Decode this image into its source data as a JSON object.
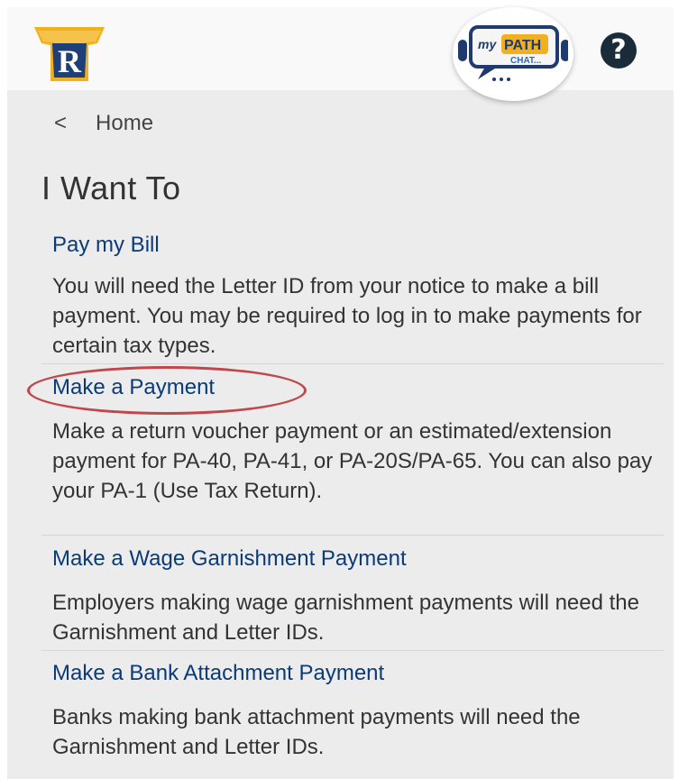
{
  "header": {
    "logo_name": "keystone-r-logo",
    "chat": {
      "prefix": "my",
      "brand": "PATH",
      "suffix": "CHAT..."
    },
    "help_icon": "?"
  },
  "breadcrumb": {
    "back_icon": "<",
    "label": "Home"
  },
  "page_title": "I Want To",
  "options": [
    {
      "link": "Pay my Bill",
      "description": "You will need the Letter ID from your notice to make a bill payment. You may be required to log in to make payments for certain tax types."
    },
    {
      "link": "Make a Payment",
      "description": "Make a return voucher payment or an estimated/extension payment for PA-40, PA-41, or PA-20S/PA-65. You can also pay your PA-1 (Use Tax Return)."
    },
    {
      "link": "Make a Wage Garnishment Payment",
      "description": "Employers making wage garnishment payments will need the Garnishment and Letter IDs."
    },
    {
      "link": "Make a Bank Attachment Payment",
      "description": "Banks making bank attachment payments will need the Garnishment and Letter IDs."
    }
  ],
  "colors": {
    "link": "#0b3a78",
    "highlight": "#c0474b",
    "background": "#ececec"
  }
}
